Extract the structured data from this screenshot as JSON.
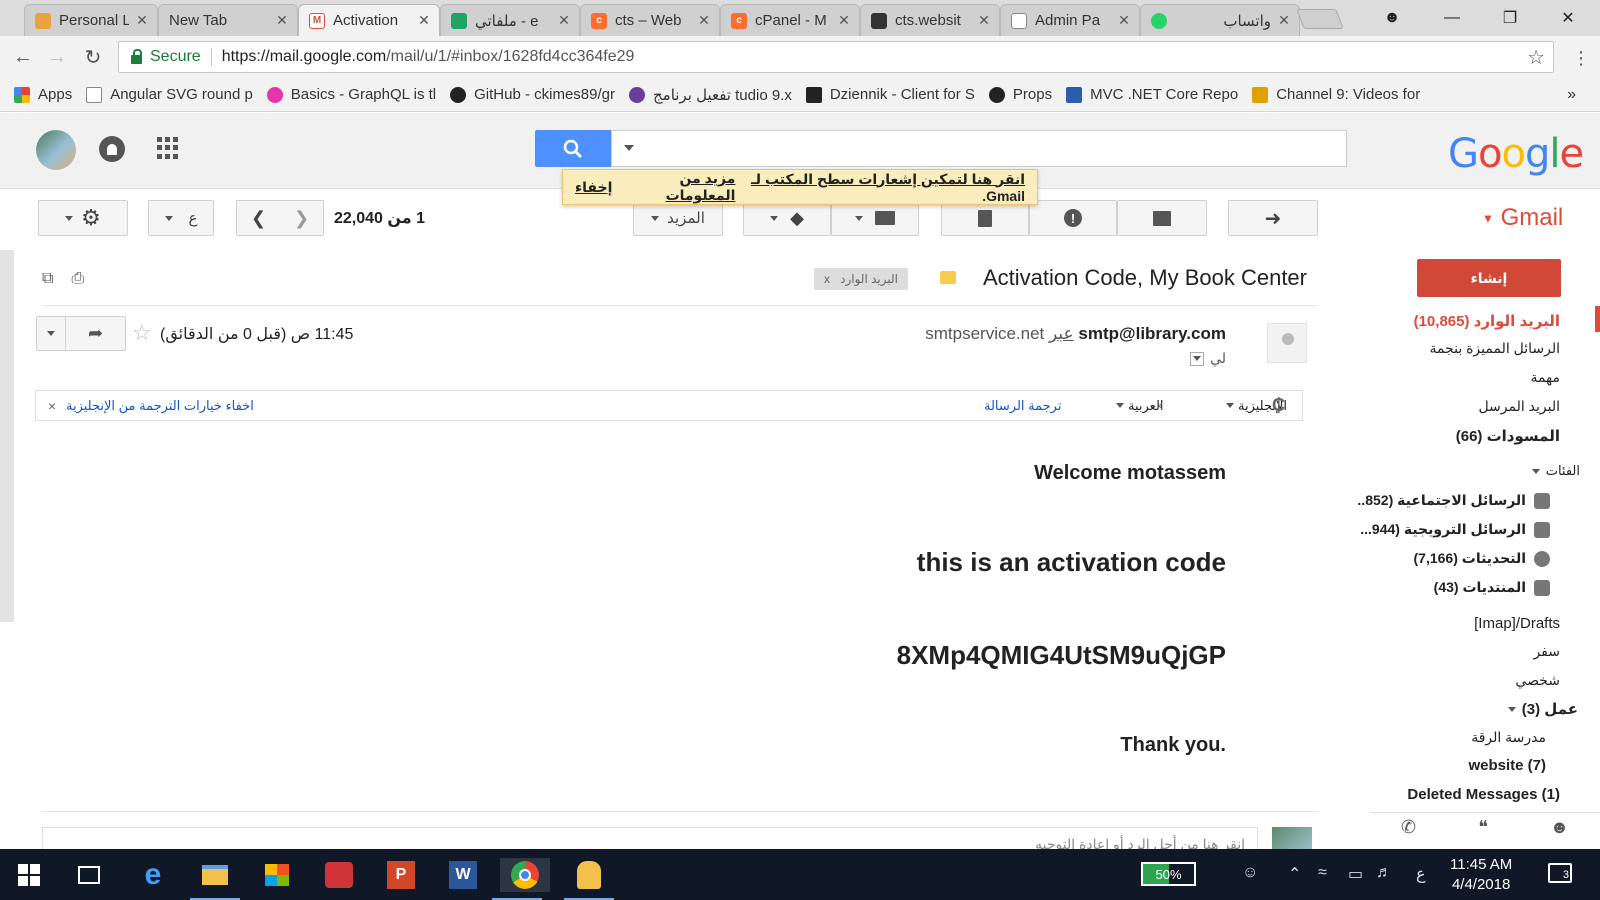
{
  "browser": {
    "tabs": [
      {
        "title": "Personal L",
        "favicon_color": "#e8a33d"
      },
      {
        "title": "New Tab",
        "favicon_color": ""
      },
      {
        "title": "Activation",
        "favicon_color": "#dd4b39"
      },
      {
        "title": "ملفاتي - e",
        "favicon_color": "#1fa463"
      },
      {
        "title": "cts – Web",
        "favicon_color": "#ff6c2c"
      },
      {
        "title": "cPanel - M",
        "favicon_color": "#ff6c2c"
      },
      {
        "title": "cts.websit",
        "favicon_color": "#333333"
      },
      {
        "title": "Admin Pa",
        "favicon_color": "#888888"
      },
      {
        "title": "واتساب",
        "favicon_color": "#25d366"
      }
    ],
    "secure_label": "Secure",
    "url_host": "https://mail.google.com",
    "url_path": "/mail/u/1/#inbox/1628fd4cc364fe29",
    "bookmarks": [
      {
        "label": "Apps",
        "color": "#4285f4"
      },
      {
        "label": "Angular SVG round p",
        "color": "#888888"
      },
      {
        "label": "Basics - GraphQL is tl",
        "color": "#e535ab"
      },
      {
        "label": "GitHub - ckimes89/gr",
        "color": "#222222"
      },
      {
        "label": "تفعيل برنامج tudio 9.x",
        "color": "#6a3d9a"
      },
      {
        "label": "Dziennik - Client for S",
        "color": "#222222"
      },
      {
        "label": "Props",
        "color": "#222222"
      },
      {
        "label": "MVC .NET Core Repo",
        "color": "#2a5db0"
      },
      {
        "label": "Channel 9: Videos for",
        "color": "#e0a000"
      }
    ],
    "bookmarks_more": "»"
  },
  "gmail": {
    "logo_text": "Google",
    "product_label": "Gmail",
    "notification": {
      "enable_text": "انقر هنا لتمكين إشعارات سطح المكتب لـ",
      "gmail": "Gmail.",
      "learn_more": "مزيد من المعلومات",
      "hide": "إخفاء"
    },
    "toolbar": {
      "more_label": "المزيد",
      "count_label": "1 من 22,040",
      "lang_key": "ع"
    },
    "sidebar": {
      "compose": "إنشاء",
      "items": [
        {
          "label": "البريد الوارد (10,865)"
        },
        {
          "label": "الرسائل المميزة بنجمة"
        },
        {
          "label": "مهمة"
        },
        {
          "label": "البريد المرسل"
        },
        {
          "label": "المسودات (66)"
        },
        {
          "label": "الفئات"
        },
        {
          "label": "الرسائل الاجتماعية (852.."
        },
        {
          "label": "الرسائل الترويجية (944..."
        },
        {
          "label": "التحديثات (7,166)"
        },
        {
          "label": "المنتديات (43)"
        },
        {
          "label": "[Imap]/Drafts"
        },
        {
          "label": "سفر"
        },
        {
          "label": "شخصي"
        },
        {
          "label": "عمل (3)"
        },
        {
          "label": "مدرسة الرقة"
        },
        {
          "label": "website (7)"
        },
        {
          "label": "Deleted Messages (1)"
        }
      ]
    },
    "email": {
      "subject": "Activation Code, My Book Center",
      "inbox_chip": "البريد الوارد",
      "inbox_chip_x": "x",
      "sender_email": "smtp@library.com",
      "via_word": "عبر",
      "via_domain": "smtpservice.net",
      "to_me": "لي",
      "time": "11:45 ص (قبل 0 من الدقائق)",
      "translation": {
        "from_lang": "الإنجليزية",
        "to_lang": "العربية",
        "translate_link": "ترجمة الرسالة",
        "hide_options": "اخفاء خيارات الترجمة من الإنجليزية",
        "close": "×"
      },
      "body": {
        "greeting": "Welcome motassem",
        "line1": "this is an activation code",
        "code": "8XMp4QMIG4UtSM9uQjGP",
        "thanks": "Thank you."
      },
      "reply_placeholder": "انقر هنا من أجل الرد أو إعادة التوجيه"
    }
  },
  "taskbar": {
    "battery": "50%",
    "input_lang": "ع",
    "time": "11:45 AM",
    "date": "4/4/2018",
    "notification_count": "3"
  }
}
